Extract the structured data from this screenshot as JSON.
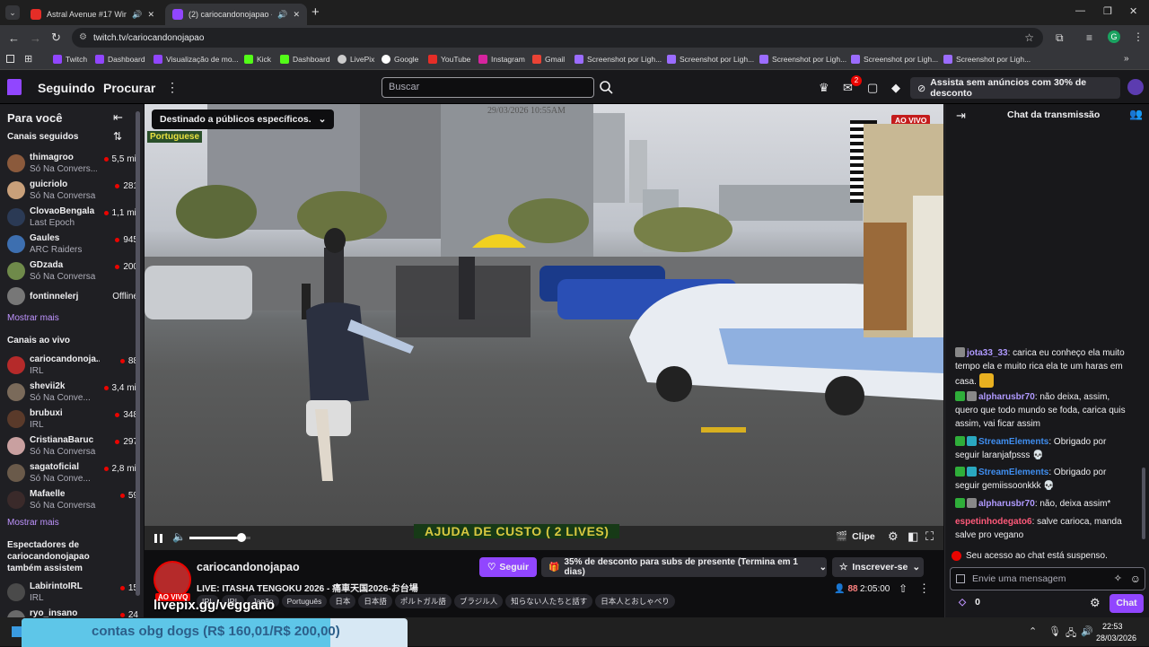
{
  "browser": {
    "tabs": [
      {
        "title": "Astral Avenue #17 Winter 2",
        "active": false
      },
      {
        "title": "(2) cariocandonojapao - Tw",
        "active": true
      }
    ],
    "url": "twitch.tv/cariocandonojapao",
    "bookmarks": [
      "Twitch",
      "Dashboard",
      "Visualização de mo...",
      "Kick",
      "Dashboard",
      "LivePix",
      "Google",
      "YouTube",
      "Instagram",
      "Gmail",
      "Screenshot por Ligh...",
      "Screenshot por Ligh...",
      "Screenshot por Ligh...",
      "Screenshot por Ligh...",
      "Screenshot por Ligh..."
    ]
  },
  "topnav": {
    "following": "Seguindo",
    "browse": "Procurar",
    "search_placeholder": "Buscar",
    "notif_count": "2",
    "prime": "Assista sem anúncios com 30% de desconto"
  },
  "sidebar": {
    "for_you": "Para você",
    "followed_title": "Canais seguidos",
    "followed": [
      {
        "name": "thimagroo",
        "game": "Só Na Convers...",
        "viewers": "5,5 mil",
        "color": "#8b5a3c"
      },
      {
        "name": "guicriolo",
        "game": "Só Na Conversa",
        "viewers": "281",
        "color": "#c9a07a"
      },
      {
        "name": "ClovaoBengala",
        "game": "Last Epoch",
        "viewers": "1,1 mil",
        "color": "#2b3a55"
      },
      {
        "name": "Gaules",
        "game": "ARC Raiders",
        "viewers": "945",
        "color": "#3d6fb0"
      },
      {
        "name": "GDzada",
        "game": "Só Na Conversa",
        "viewers": "200",
        "color": "#6f8a4a"
      },
      {
        "name": "fontinnelerj",
        "game": "",
        "viewers": "Offline",
        "color": "#777"
      }
    ],
    "show_more": "Mostrar mais",
    "live_title": "Canais ao vivo",
    "live": [
      {
        "name": "cariocandonoja...",
        "game": "IRL",
        "viewers": "88",
        "color": "#b52a2a"
      },
      {
        "name": "shevii2k",
        "game": "Só Na Conve...",
        "viewers": "3,4 mil",
        "color": "#7a6a5a"
      },
      {
        "name": "brubuxi",
        "game": "IRL",
        "viewers": "348",
        "color": "#5a3a2a"
      },
      {
        "name": "CristianaBaruc",
        "game": "Só Na Conversa",
        "viewers": "297",
        "color": "#c9a0a0"
      },
      {
        "name": "sagatoficial",
        "game": "Só Na Conve...",
        "viewers": "2,8 mil",
        "color": "#6a5a4a"
      },
      {
        "name": "Mafaelle",
        "game": "Só Na Conversa",
        "viewers": "59",
        "color": "#3a2a2a"
      }
    ],
    "show_more2": "Mostrar mais",
    "also_title": "Espectadores de cariocandonojapao também assistem",
    "also": [
      {
        "name": "LabirintoIRL",
        "game": "IRL",
        "viewers": "15",
        "color": "#4a4a4a"
      },
      {
        "name": "ryo_insano",
        "game": "",
        "viewers": "24",
        "color": "#6a6a6a"
      }
    ]
  },
  "video": {
    "audience_label": "Destinado a públicos específicos.",
    "stamp": "29/03/2026 10:55AM",
    "lang_label": "Portuguese",
    "live_badge": "AO VIVO",
    "banner": "AJUDA DE CUSTO ( 2 LIVES)",
    "clip": "Clipe",
    "volume_pct": 85
  },
  "stream": {
    "channel": "cariocandonojapao",
    "live_badge": "AO VIVO",
    "title": "LIVE: ITASHA TENGOKU 2026 - 痛車天国2026-お台場",
    "tags": [
      "IRL",
      "IRL",
      "Japão",
      "Português",
      "日本",
      "日本語",
      "ポルトガル語",
      "ブラジル人",
      "知らない人たちと話す",
      "日本人とおしゃべり"
    ],
    "follow": "Seguir",
    "gift": "35% de desconto para subs de presente (Termina em 1 dias)",
    "subscribe": "Inscrever-se",
    "viewers": "88",
    "uptime": "2:05:00",
    "overlay": "livepix.gg/veggano"
  },
  "chat": {
    "header": "Chat da transmissão",
    "messages": [
      {
        "user": "jota33_33",
        "color": "#b09aff",
        "text": ": carica eu conheço ela muito tempo ela e muito rica ela te um haras em casa."
      },
      {
        "user": "alpharusbr70",
        "color": "#b09aff",
        "text": ": não deixa, assim, quero que todo mundo se foda, carica quis assim, vai ficar assim"
      },
      {
        "user": "StreamElements",
        "color": "#3f8ef0",
        "text": ": Obrigado por seguir laranjafpsss"
      },
      {
        "user": "StreamElements",
        "color": "#3f8ef0",
        "text": ": Obrigado por seguir gemiissoonkkk"
      },
      {
        "user": "alpharusbr70",
        "color": "#b09aff",
        "text": ": não, deixa assim*"
      },
      {
        "user": "espetinhodegato6",
        "color": "#ff5a7a",
        "text": ": salve carioca, manda salve pro vegano"
      }
    ],
    "suspended": "Seu acesso ao chat está suspenso.",
    "placeholder": "Envie uma mensagem",
    "points": "0",
    "send": "Chat"
  },
  "taskbar": {
    "ticker": "contas obg dogs (R$ 160,01/R$ 200,00)",
    "time": "22:53",
    "date": "28/03/2026"
  }
}
